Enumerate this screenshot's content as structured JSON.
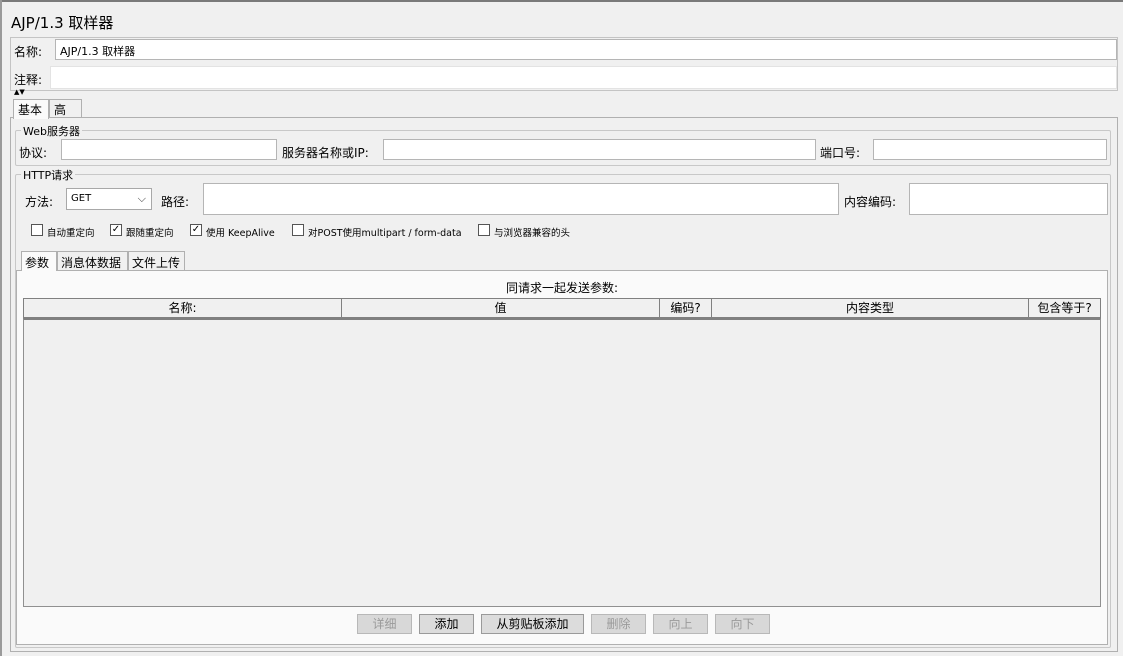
{
  "window": {
    "title": "AJP/1.3 取样器"
  },
  "header": {
    "name_label": "名称:",
    "name_value": "AJP/1.3 取样器",
    "comment_label": "注释:",
    "comment_value": ""
  },
  "tabs": [
    {
      "label": "基本",
      "active": true
    },
    {
      "label": "高级",
      "active": false
    }
  ],
  "web_server": {
    "group_title": "Web服务器",
    "protocol_label": "协议:",
    "protocol_value": "",
    "server_label": "服务器名称或IP:",
    "server_value": "",
    "port_label": "端口号:",
    "port_value": ""
  },
  "http_request": {
    "group_title": "HTTP请求",
    "method_label": "方法:",
    "method_value": "GET",
    "path_label": "路径:",
    "path_value": "",
    "encoding_label": "内容编码:",
    "encoding_value": "",
    "checkboxes": [
      {
        "label": "自动重定向",
        "checked": false
      },
      {
        "label": "跟随重定向",
        "checked": true
      },
      {
        "label": "使用 KeepAlive",
        "checked": true
      },
      {
        "label": "对POST使用multipart / form-data",
        "checked": false
      },
      {
        "label": "与浏览器兼容的头",
        "checked": false
      }
    ]
  },
  "sub_tabs": [
    {
      "label": "参数",
      "active": true
    },
    {
      "label": "消息体数据",
      "active": false
    },
    {
      "label": "文件上传",
      "active": false
    }
  ],
  "params_table": {
    "caption": "同请求一起发送参数:",
    "columns": [
      "名称:",
      "值",
      "编码?",
      "内容类型",
      "包含等于?"
    ],
    "rows": []
  },
  "buttons": [
    {
      "label": "详细",
      "enabled": false
    },
    {
      "label": "添加",
      "enabled": true
    },
    {
      "label": "从剪贴板添加",
      "enabled": true
    },
    {
      "label": "删除",
      "enabled": false
    },
    {
      "label": "向上",
      "enabled": false
    },
    {
      "label": "向下",
      "enabled": false
    }
  ],
  "checkmark_glyph": "✓",
  "chevron_glyph": "⌵"
}
